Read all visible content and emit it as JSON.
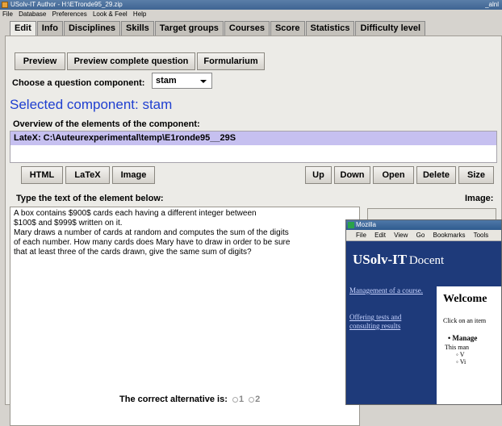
{
  "titlebar": {
    "title": "USolv-IT Author - H:\\ETronde95_29.zip",
    "right_text": "_alnl"
  },
  "menubar": [
    "File",
    "Database",
    "Preferences",
    "Look & Feel",
    "Help"
  ],
  "tabs": [
    "Edit",
    "Info",
    "Disciplines",
    "Skills",
    "Target groups",
    "Courses",
    "Score",
    "Statistics",
    "Difficulty level"
  ],
  "toolbar": {
    "preview": "Preview",
    "preview_complete": "Preview complete question",
    "formularium": "Formularium"
  },
  "component": {
    "choose_label": "Choose a question component:",
    "selected_value": "stam",
    "selected_heading": "Selected component: stam",
    "overview_label": "Overview of the elements of the component:",
    "overview_items": [
      "LateX: C:\\Auteurexperimental\\temp\\E1ronde95__29S"
    ]
  },
  "element_buttons": {
    "html": "HTML",
    "latex": "LaTeX",
    "image": "Image",
    "up": "Up",
    "down": "Down",
    "open": "Open",
    "delete": "Delete",
    "size": "Size"
  },
  "editor": {
    "label": "Type the text of the element below:",
    "image_label": "Image:",
    "lines": [
      "A box contains $900$ cards each having a different integer between",
      "$100$ and $999$ written on it.",
      "Mary draws a number of cards at random and computes the sum of the digits",
      "of each number. How many cards does Mary have to draw in order to be sure",
      "that at least three of the cards drawn, give the same sum of digits?"
    ]
  },
  "correct": {
    "label": "The correct alternative is:",
    "options": [
      "1",
      "2"
    ]
  },
  "mozilla": {
    "title": "Mozilla",
    "menu": [
      "File",
      "Edit",
      "View",
      "Go",
      "Bookmarks",
      "Tools"
    ],
    "logo": "USolv-IT",
    "logo_sub": "Docent",
    "nav_links": [
      "Management of a course.",
      "Offering tests and consulting results"
    ],
    "welcome": "Welcome",
    "click_text": "Click on an item",
    "bullet": "Manage",
    "sub_text": "This man",
    "sub_items": [
      "V",
      "Vi"
    ]
  }
}
